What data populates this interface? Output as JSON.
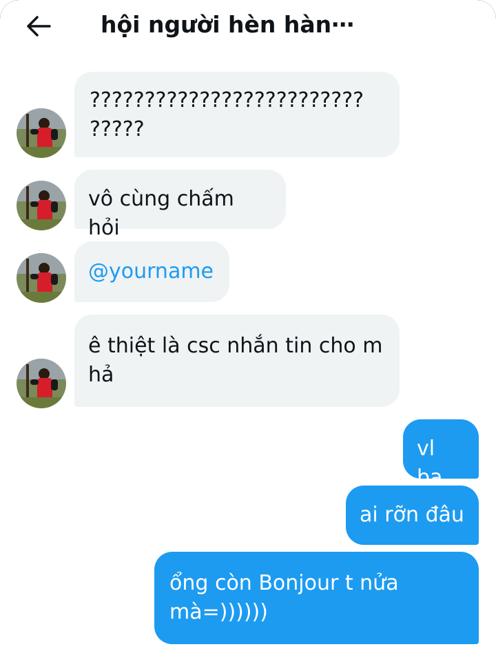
{
  "header": {
    "title": "hội người hèn hàn⋯",
    "back_icon": "arrow-left-icon"
  },
  "messages": [
    {
      "direction": "in",
      "text": "????????????????????????? ?????"
    },
    {
      "direction": "in",
      "text": "vô cùng chấm hỏi"
    },
    {
      "direction": "in",
      "text": "@yourname"
    },
    {
      "direction": "in",
      "text": "ê thiệt là csc nhắn tin cho m hả"
    },
    {
      "direction": "out",
      "text": "vl ba"
    },
    {
      "direction": "out",
      "text": "ai rỡn đâu"
    },
    {
      "direction": "out",
      "text": "ổng còn Bonjour t nửa mà=))))))"
    }
  ],
  "colors": {
    "incoming_bubble": "#eff3f4",
    "outgoing_bubble": "#1d9bf0",
    "mention": "#1d9bf0"
  }
}
